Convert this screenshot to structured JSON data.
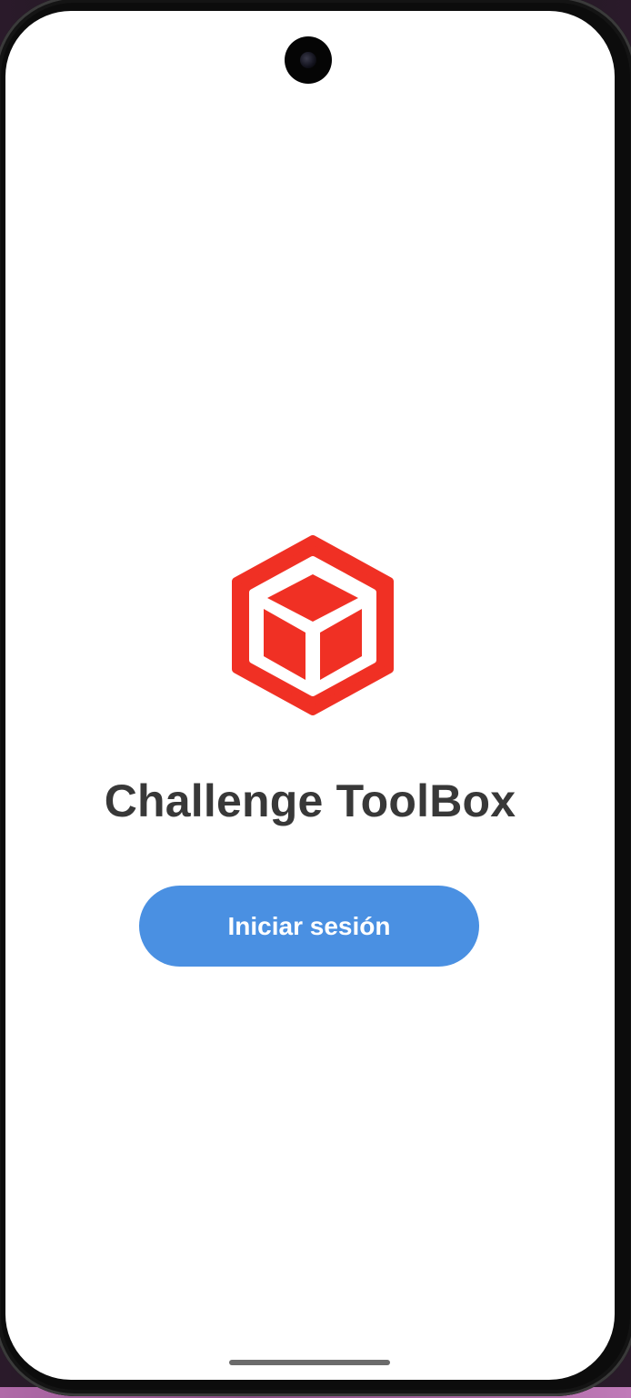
{
  "app": {
    "title": "Challenge ToolBox",
    "logo_icon": "cube-hexagon-icon"
  },
  "actions": {
    "login_label": "Iniciar sesión"
  },
  "colors": {
    "logo_red": "#f03024",
    "button_blue": "#4a90e2",
    "title_text": "#383838",
    "background": "#ffffff"
  }
}
